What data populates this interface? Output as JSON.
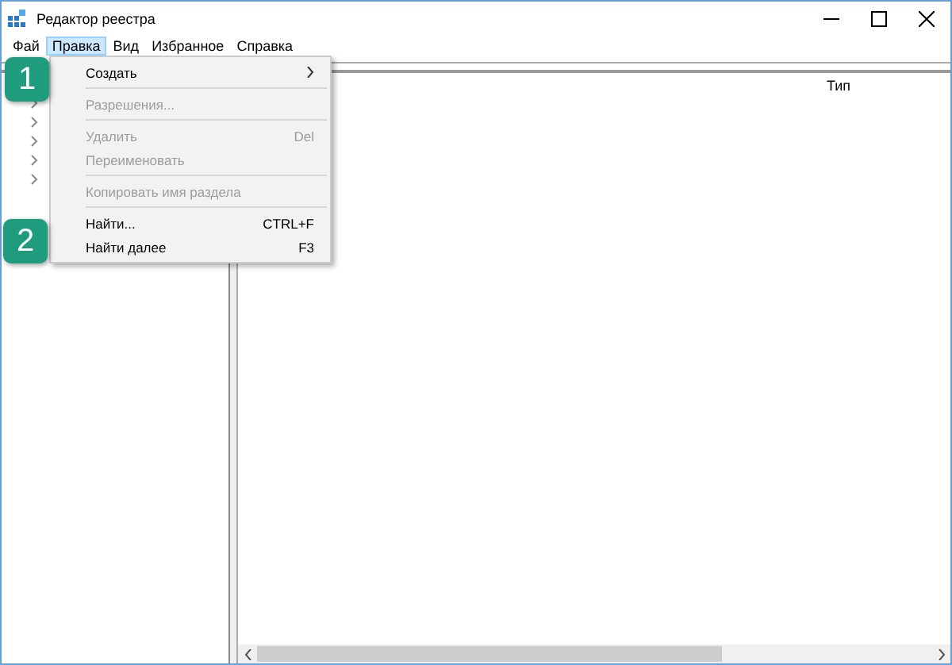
{
  "window": {
    "title": "Редактор реестра"
  },
  "menu_bar": [
    {
      "label": "Фай",
      "selected": false
    },
    {
      "label": "Правка",
      "selected": true
    },
    {
      "label": "Вид",
      "selected": false
    },
    {
      "label": "Избранное",
      "selected": false
    },
    {
      "label": "Справка",
      "selected": false
    }
  ],
  "dropdown": [
    {
      "kind": "item",
      "label": "Создать",
      "disabled": false,
      "submenu": true
    },
    {
      "kind": "separator"
    },
    {
      "kind": "item",
      "label": "Разрешения...",
      "disabled": true,
      "submenu": false
    },
    {
      "kind": "separator"
    },
    {
      "kind": "item",
      "label": "Удалить",
      "shortcut": "Del",
      "disabled": true,
      "submenu": false
    },
    {
      "kind": "item",
      "label": "Переименовать",
      "disabled": true,
      "submenu": false
    },
    {
      "kind": "separator"
    },
    {
      "kind": "item",
      "label": "Копировать имя раздела",
      "disabled": true,
      "submenu": false
    },
    {
      "kind": "separator"
    },
    {
      "kind": "item",
      "label": "Найти...",
      "shortcut": "CTRL+F",
      "disabled": false,
      "submenu": false
    },
    {
      "kind": "item",
      "label": "Найти далее",
      "shortcut": "F3",
      "disabled": false,
      "submenu": false
    }
  ],
  "tree": {
    "children": [
      {
        "expanded": false
      },
      {
        "expanded": false
      },
      {
        "expanded": false
      },
      {
        "expanded": false
      },
      {
        "expanded": false
      }
    ]
  },
  "list": {
    "columns": [
      {
        "label": "Тип"
      }
    ]
  },
  "step_badges": [
    {
      "label": "1"
    },
    {
      "label": "2"
    }
  ]
}
